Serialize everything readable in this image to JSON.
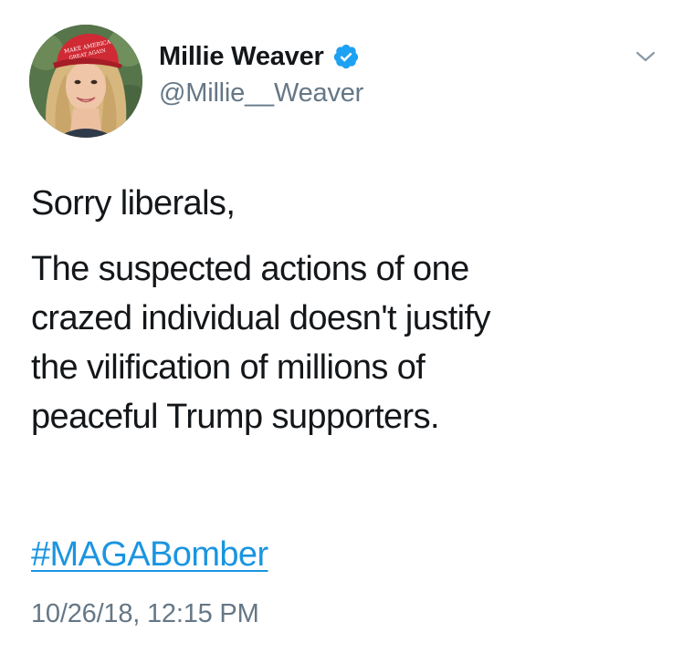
{
  "author": {
    "display_name": "Millie Weaver",
    "handle": "@Millie__Weaver",
    "verified": true,
    "avatar_hat_text": "MAKE AMERICA GREAT AGAIN"
  },
  "icons": {
    "verified": "verified-badge-icon",
    "menu": "chevron-down-icon"
  },
  "tweet": {
    "greeting": "Sorry liberals,",
    "body_lines": [
      "The suspected actions of one",
      "crazed individual doesn't justify",
      "the vilification of millions of",
      "peaceful Trump supporters."
    ],
    "hashtag": "#MAGABomber",
    "timestamp": "10/26/18, 12:15 PM"
  },
  "colors": {
    "text": "#14171a",
    "secondary": "#657786",
    "link": "#1b95e0",
    "verified": "#1da1f2"
  }
}
